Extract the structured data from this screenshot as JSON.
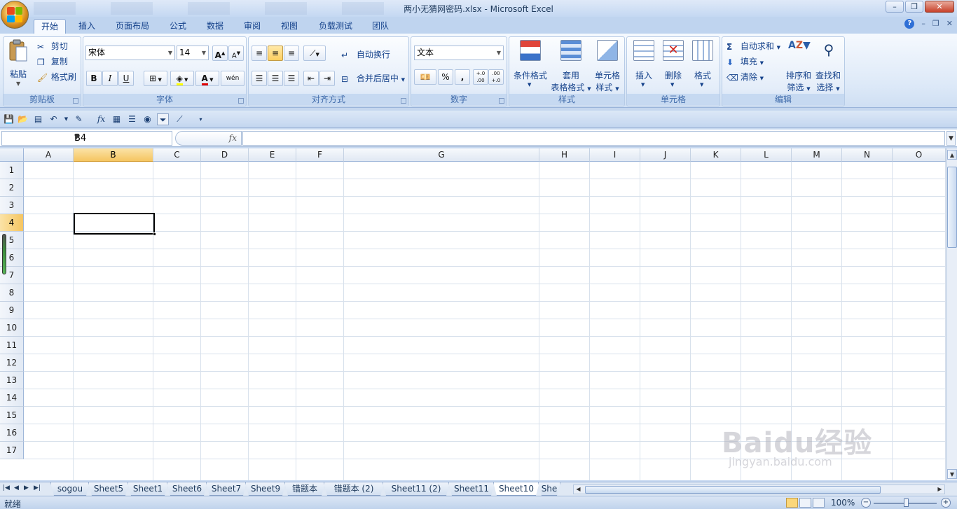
{
  "window": {
    "title": "两小无猜网密码.xlsx - Microsoft Excel",
    "controls": {
      "minimize": "–",
      "restore": "❐",
      "close": "✕"
    }
  },
  "tabs": [
    {
      "label": "开始",
      "active": true
    },
    {
      "label": "插入"
    },
    {
      "label": "页面布局"
    },
    {
      "label": "公式"
    },
    {
      "label": "数据"
    },
    {
      "label": "审阅"
    },
    {
      "label": "视图"
    },
    {
      "label": "负载测试"
    },
    {
      "label": "团队"
    }
  ],
  "ribbon": {
    "clipboard": {
      "label": "剪贴板",
      "paste": "粘贴",
      "cut": "剪切",
      "copy": "复制",
      "format_painter": "格式刷"
    },
    "font": {
      "label": "字体",
      "font_name": "宋体",
      "font_size": "14",
      "bold": "B",
      "italic": "I",
      "underline": "U",
      "grow": "A",
      "shrink": "A",
      "font_color_letter": "A",
      "phonetic": "wén"
    },
    "alignment": {
      "label": "对齐方式",
      "wrap_text": "自动换行",
      "merge_center": "合并后居中"
    },
    "number": {
      "label": "数字",
      "format": "文本",
      "percent": "%",
      "comma": ",",
      "inc_decimal": "+.0 .00",
      "dec_decimal": ".00 +.0"
    },
    "styles": {
      "label": "样式",
      "conditional": "条件格式",
      "table_format_1": "套用",
      "table_format_2": "表格格式",
      "cell_styles_1": "单元格",
      "cell_styles_2": "样式"
    },
    "cells": {
      "label": "单元格",
      "insert": "插入",
      "delete": "删除",
      "format": "格式"
    },
    "editing": {
      "label": "编辑",
      "autosum": "自动求和",
      "fill": "填充",
      "clear": "清除",
      "sort_1": "排序和",
      "sort_2": "筛选",
      "find_1": "查找和",
      "find_2": "选择"
    }
  },
  "formula_bar": {
    "name_box": "B4",
    "fx": "fx",
    "value": ""
  },
  "grid": {
    "columns": [
      "A",
      "B",
      "C",
      "D",
      "E",
      "F",
      "G",
      "H",
      "I",
      "J",
      "K",
      "L",
      "M",
      "N",
      "O"
    ],
    "rows": [
      "1",
      "2",
      "3",
      "4",
      "5",
      "6",
      "7",
      "8",
      "9",
      "10",
      "11",
      "12",
      "13",
      "14",
      "15",
      "16",
      "17"
    ],
    "selected_column": "B",
    "selected_row": "4"
  },
  "sheets": [
    {
      "label": "sogou"
    },
    {
      "label": "Sheet5"
    },
    {
      "label": "Sheet1"
    },
    {
      "label": "Sheet6"
    },
    {
      "label": "Sheet7"
    },
    {
      "label": "Sheet9"
    },
    {
      "label": "错题本"
    },
    {
      "label": "错题本 (2)"
    },
    {
      "label": "Sheet11 (2)"
    },
    {
      "label": "Sheet11"
    },
    {
      "label": "Sheet10",
      "active": true
    },
    {
      "label": "She"
    }
  ],
  "status": {
    "ready": "就绪",
    "zoom": "100%"
  },
  "watermark": {
    "brand": "Baidu经验",
    "url": "jingyan.baidu.com"
  }
}
